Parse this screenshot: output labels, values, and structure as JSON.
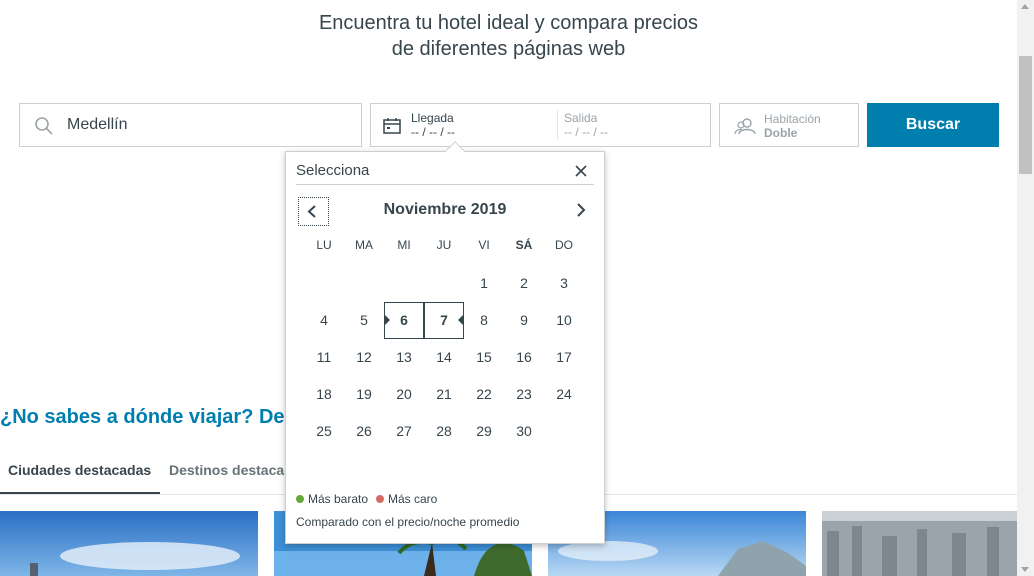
{
  "hero": {
    "line1": "Encuentra tu hotel ideal y compara precios",
    "line2": "de diferentes páginas web"
  },
  "search": {
    "destination_value": "Medellín",
    "checkin_label": "Llegada",
    "checkin_value": "-- / -- / --",
    "checkout_label": "Salida",
    "checkout_value": "-- / -- / --",
    "room_label": "Habitación",
    "room_value": "Doble",
    "button_label": "Buscar",
    "accent_color": "#007faf"
  },
  "section": {
    "title": "¿No sabes a dónde viajar? De",
    "tabs": [
      {
        "label": "Ciudades destacadas",
        "active": true
      },
      {
        "label": "Destinos destaca",
        "active": false
      }
    ]
  },
  "calendar": {
    "title": "Selecciona",
    "month_label": "Noviembre 2019",
    "weekdays": [
      "LU",
      "MA",
      "MI",
      "JU",
      "VI",
      "SÁ",
      "DO"
    ],
    "bold_weekday": "SÁ",
    "first_weekday_index": 4,
    "days_in_month": 30,
    "selected_days": [
      6,
      7
    ],
    "legend": [
      {
        "label": "Más barato",
        "color": "#65a83c"
      },
      {
        "label": "Más caro",
        "color": "#d76a63"
      }
    ],
    "note": "Comparado con el precio/noche promedio"
  }
}
